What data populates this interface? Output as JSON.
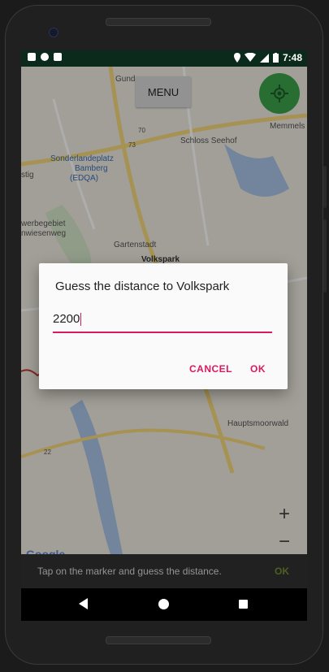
{
  "status_bar": {
    "time": "7:48",
    "left_icons": [
      "notification-a-icon",
      "record-icon",
      "sd-card-icon"
    ],
    "right_icons": [
      "location-pin-icon",
      "wifi-icon",
      "signal-icon",
      "battery-icon"
    ]
  },
  "toolbar": {
    "menu_label": "MENU",
    "location_icon": "my-location-icon"
  },
  "map": {
    "labels": [
      "Gund",
      "Memmels",
      "Schloss Seehof",
      "Sonderlandeplatz",
      "Bamberg",
      "(EDQA)",
      "stig",
      "werbegebiet",
      "nwiesenweg",
      "Gartenstadt",
      "Volkspark",
      "Hauptsmoorwald",
      "70",
      "73",
      "22"
    ],
    "attribution": "Google",
    "zoom_in": "+",
    "zoom_out": "−"
  },
  "dialog": {
    "title": "Guess the distance to Volkspark",
    "input_value": "2200",
    "cancel_label": "CANCEL",
    "ok_label": "OK"
  },
  "snackbar": {
    "message": "Tap on the marker and guess the distance.",
    "action": "OK"
  },
  "colors": {
    "accent": "#d81b60",
    "location_button": "#3ba34a",
    "status_bar": "#0b2a1b",
    "snackbar": "#323232"
  }
}
